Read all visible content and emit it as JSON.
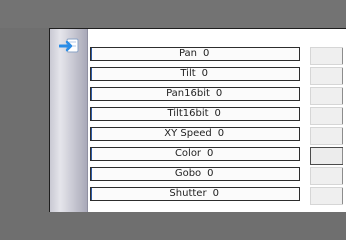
{
  "colors": {
    "background": "#6f6f6f",
    "panel": "#ffffff",
    "row_fill": "#fbfbfb",
    "row_border": "#2d2d2d",
    "accent": "#2b5aa6"
  },
  "toolbar": {
    "icon": "import-arrow-icon"
  },
  "channels": [
    {
      "label": "Pan",
      "value": "0"
    },
    {
      "label": "Tilt",
      "value": "0"
    },
    {
      "label": "Pan16bit",
      "value": "0"
    },
    {
      "label": "Tilt16bit",
      "value": "0"
    },
    {
      "label": "XY Speed",
      "value": "0"
    },
    {
      "label": "Color",
      "value": "0"
    },
    {
      "label": "Gobo",
      "value": "0"
    },
    {
      "label": "Shutter",
      "value": "0"
    }
  ]
}
